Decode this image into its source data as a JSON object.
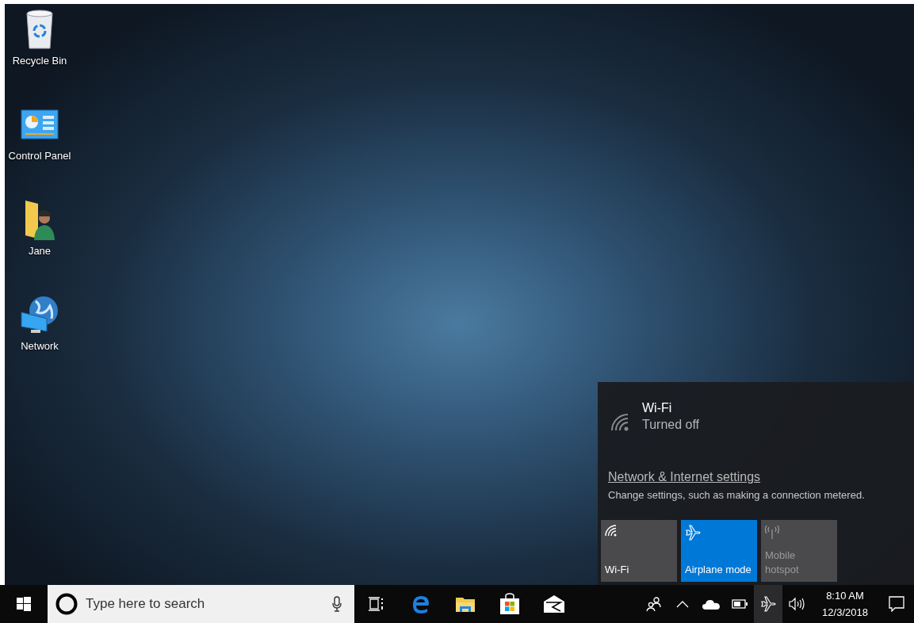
{
  "desktop_icons": [
    {
      "kind": "recycle-bin",
      "label": "Recycle Bin"
    },
    {
      "kind": "control-panel",
      "label": "Control Panel"
    },
    {
      "kind": "user-folder",
      "label": "Jane"
    },
    {
      "kind": "network",
      "label": "Network"
    }
  ],
  "network_flyout": {
    "wifi": {
      "title": "Wi-Fi",
      "status": "Turned off"
    },
    "settings_link": "Network & Internet settings",
    "description": "Change settings, such as making a connection metered.",
    "quick_actions": [
      {
        "kind": "wifi",
        "label": "Wi-Fi",
        "on": false,
        "disabled": false
      },
      {
        "kind": "airplane",
        "label": "Airplane mode",
        "on": true,
        "disabled": false
      },
      {
        "kind": "hotspot",
        "label": "Mobile hotspot",
        "on": false,
        "disabled": true
      }
    ]
  },
  "taskbar": {
    "search": {
      "placeholder": "Type here to search"
    },
    "network_button_selected": true,
    "clock": {
      "time": "8:10 AM",
      "date": "12/3/2018"
    }
  }
}
